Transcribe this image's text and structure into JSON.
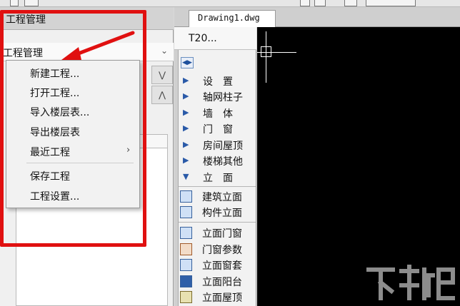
{
  "left_panel": {
    "title": "工程管理",
    "project_select": {
      "label": "工程管理"
    }
  },
  "context_menu": {
    "items": [
      {
        "label": "新建工程..."
      },
      {
        "label": "打开工程..."
      },
      {
        "label": "导入楼层表..."
      },
      {
        "label": "导出楼层表"
      },
      {
        "label": "最近工程",
        "has_submenu": true
      },
      {
        "label": "保存工程"
      },
      {
        "label": "工程设置..."
      }
    ],
    "submenu_arrow": "›"
  },
  "document_tab": {
    "label": "Drawing1.dwg"
  },
  "tool_palette": {
    "title": "T20...",
    "categories": [
      {
        "label": "设　置"
      },
      {
        "label": "轴网柱子"
      },
      {
        "label": "墙　体"
      },
      {
        "label": "门　窗"
      },
      {
        "label": "房间屋顶"
      },
      {
        "label": "楼梯其他"
      },
      {
        "label": "立　面",
        "expanded": true
      }
    ],
    "tools": [
      {
        "label": "建筑立面",
        "icon": "building-elevation-icon"
      },
      {
        "label": "构件立面",
        "icon": "component-elevation-icon"
      },
      {
        "label": "立面门窗",
        "icon": "elevation-door-window-icon"
      },
      {
        "label": "门窗参数",
        "icon": "door-window-params-icon"
      },
      {
        "label": "立面窗套",
        "icon": "window-frame-icon"
      },
      {
        "label": "立面阳台",
        "icon": "balcony-icon"
      },
      {
        "label": "立面屋顶",
        "icon": "roof-icon"
      }
    ]
  },
  "colors": {
    "highlight_red": "#e01010",
    "canvas_bg": "#000000",
    "palette_blue": "#2a5aa8"
  }
}
